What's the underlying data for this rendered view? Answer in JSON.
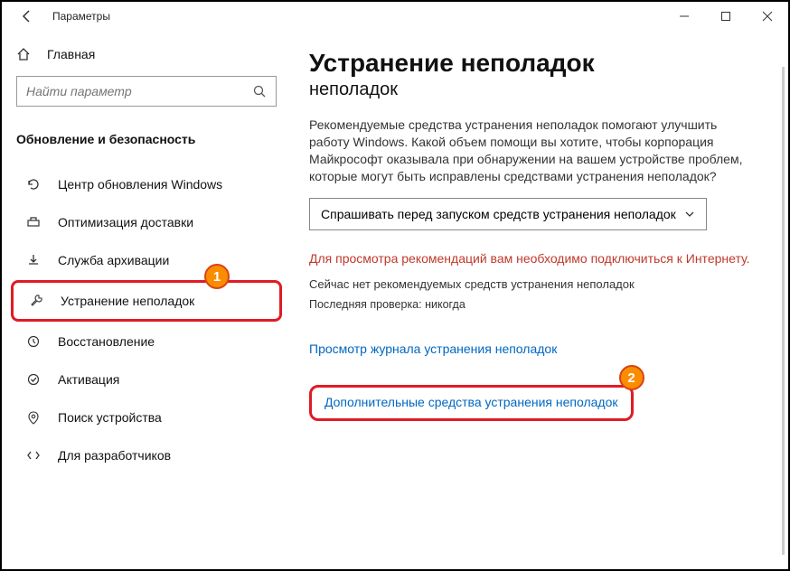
{
  "window": {
    "title": "Параметры"
  },
  "sidebar": {
    "home": "Главная",
    "search_placeholder": "Найти параметр",
    "category": "Обновление и безопасность",
    "items": [
      {
        "label": "Центр обновления Windows"
      },
      {
        "label": "Оптимизация доставки"
      },
      {
        "label": "Служба архивации"
      },
      {
        "label": "Устранение неполадок"
      },
      {
        "label": "Восстановление"
      },
      {
        "label": "Активация"
      },
      {
        "label": "Поиск устройства"
      },
      {
        "label": "Для разработчиков"
      }
    ]
  },
  "main": {
    "heading": "Устранение неполадок",
    "subheading": "неполадок",
    "description": "Рекомендуемые средства устранения неполадок помогают улучшить работу Windows. Какой объем помощи вы хотите, чтобы корпорация Майкрософт оказывала при обнаружении на вашем устройстве проблем, которые могут быть исправлены средствами устранения неполадок?",
    "dropdown_value": "Спрашивать перед запуском средств устранения неполадок",
    "error": "Для просмотра рекомендаций вам необходимо подключиться к Интернету.",
    "no_recommended": "Сейчас нет рекомендуемых средств устранения неполадок",
    "last_check": "Последняя проверка: никогда",
    "link_history": "Просмотр журнала устранения неполадок",
    "link_additional": "Дополнительные средства устранения неполадок"
  },
  "badges": {
    "one": "1",
    "two": "2"
  }
}
